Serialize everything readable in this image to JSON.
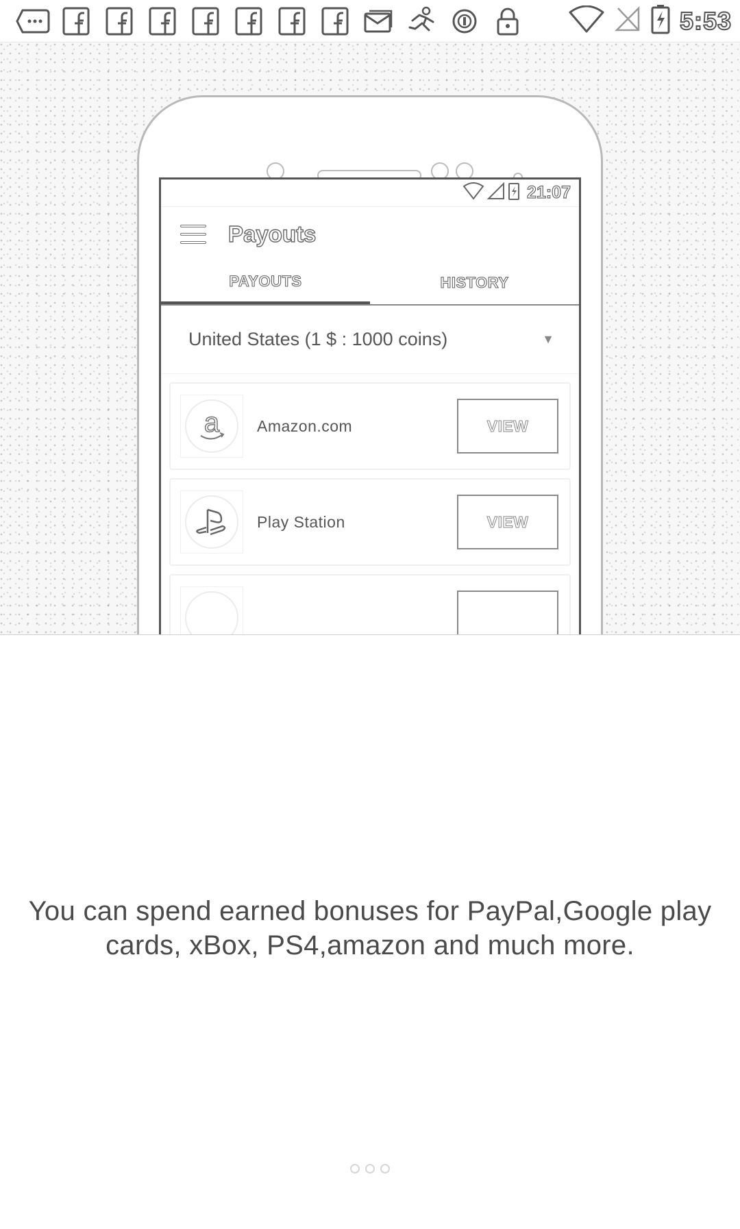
{
  "status_bar": {
    "notification_icons": [
      "chat-bubble-icon",
      "facebook-icon",
      "facebook-icon",
      "facebook-icon",
      "facebook-icon",
      "facebook-icon",
      "facebook-icon",
      "facebook-icon",
      "mail-icon",
      "fitness-runner-icon",
      "circle-info-icon",
      "lock-icon"
    ],
    "time": "5:53"
  },
  "phone_preview": {
    "status_time": "21:07",
    "app_title": "Payouts",
    "tabs": [
      {
        "label": "PAYOUTS",
        "active": true
      },
      {
        "label": "HISTORY",
        "active": false
      }
    ],
    "country_selector": "United States (1 $ : 1000 coins)",
    "payouts": [
      {
        "name": "Amazon.com",
        "logo": "amazon-logo-icon",
        "button": "VIEW"
      },
      {
        "name": "Play Station",
        "logo": "playstation-logo-icon",
        "button": "VIEW"
      }
    ]
  },
  "caption": "You can spend earned bonuses for PayPal,Google play cards, xBox, PS4,amazon and much more.",
  "pager": {
    "count": 3,
    "active_index": 0
  }
}
